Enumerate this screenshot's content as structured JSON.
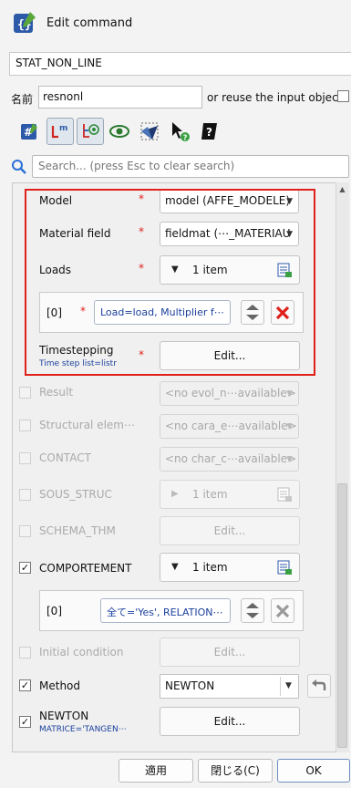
{
  "header": {
    "title": "Edit command",
    "app_icon": "code-brackets-icon"
  },
  "command_name": "STAT_NON_LINE",
  "name_row": {
    "label": "名前",
    "value": "resnonl",
    "reuse_label": "or reuse the input object"
  },
  "toolbar": {
    "icons": [
      "hash-icon",
      "lm-icon",
      "tree-view-icon",
      "eye-icon",
      "mesh-icon",
      "pointer-help-icon",
      "help-book-icon"
    ]
  },
  "search": {
    "placeholder": "Search... (press Esc to clear search)"
  },
  "params": {
    "model": {
      "label": "Model",
      "star": "*",
      "value": "model (AFFE_MODELE)"
    },
    "material_field": {
      "label": "Material field",
      "star": "*",
      "value": "fieldmat (⋯_MATERIAU"
    },
    "loads": {
      "label": "Loads",
      "star": "*",
      "count": "1 item",
      "item": {
        "index": "[0]",
        "star": "*",
        "text": "Load=load, Multiplier f⋯"
      }
    },
    "timestepping": {
      "label": "Timestepping",
      "star": "*",
      "sub": "Time step list=listr",
      "button": "Edit..."
    },
    "result": {
      "label": "Result",
      "value": "<no evol_n⋯available>"
    },
    "structural": {
      "label": "Structural elem⋯",
      "value": "<no cara_e⋯available>"
    },
    "contact": {
      "label": "CONTACT",
      "value": "<no char_c⋯available>"
    },
    "sous_struc": {
      "label": "SOUS_STRUC",
      "count": "1 item"
    },
    "schema_thm": {
      "label": "SCHEMA_THM",
      "button": "Edit..."
    },
    "comportement": {
      "label": "COMPORTEMENT",
      "count": "1 item",
      "item": {
        "index": "[0]",
        "text": "全て='Yes', RELATION⋯"
      }
    },
    "initial_condition": {
      "label": "Initial condition",
      "button": "Edit..."
    },
    "method": {
      "label": "Method",
      "value": "NEWTON"
    },
    "newton": {
      "label": "NEWTON",
      "sub": "MATRICE='TANGEN⋯",
      "button": "Edit..."
    }
  },
  "footer": {
    "apply": "適用",
    "close": "閉じる(C)",
    "ok": "OK"
  },
  "colors": {
    "required_star": "#e0201b",
    "highlight_box": "#e0201b",
    "sub_text": "#1a3f9c"
  }
}
